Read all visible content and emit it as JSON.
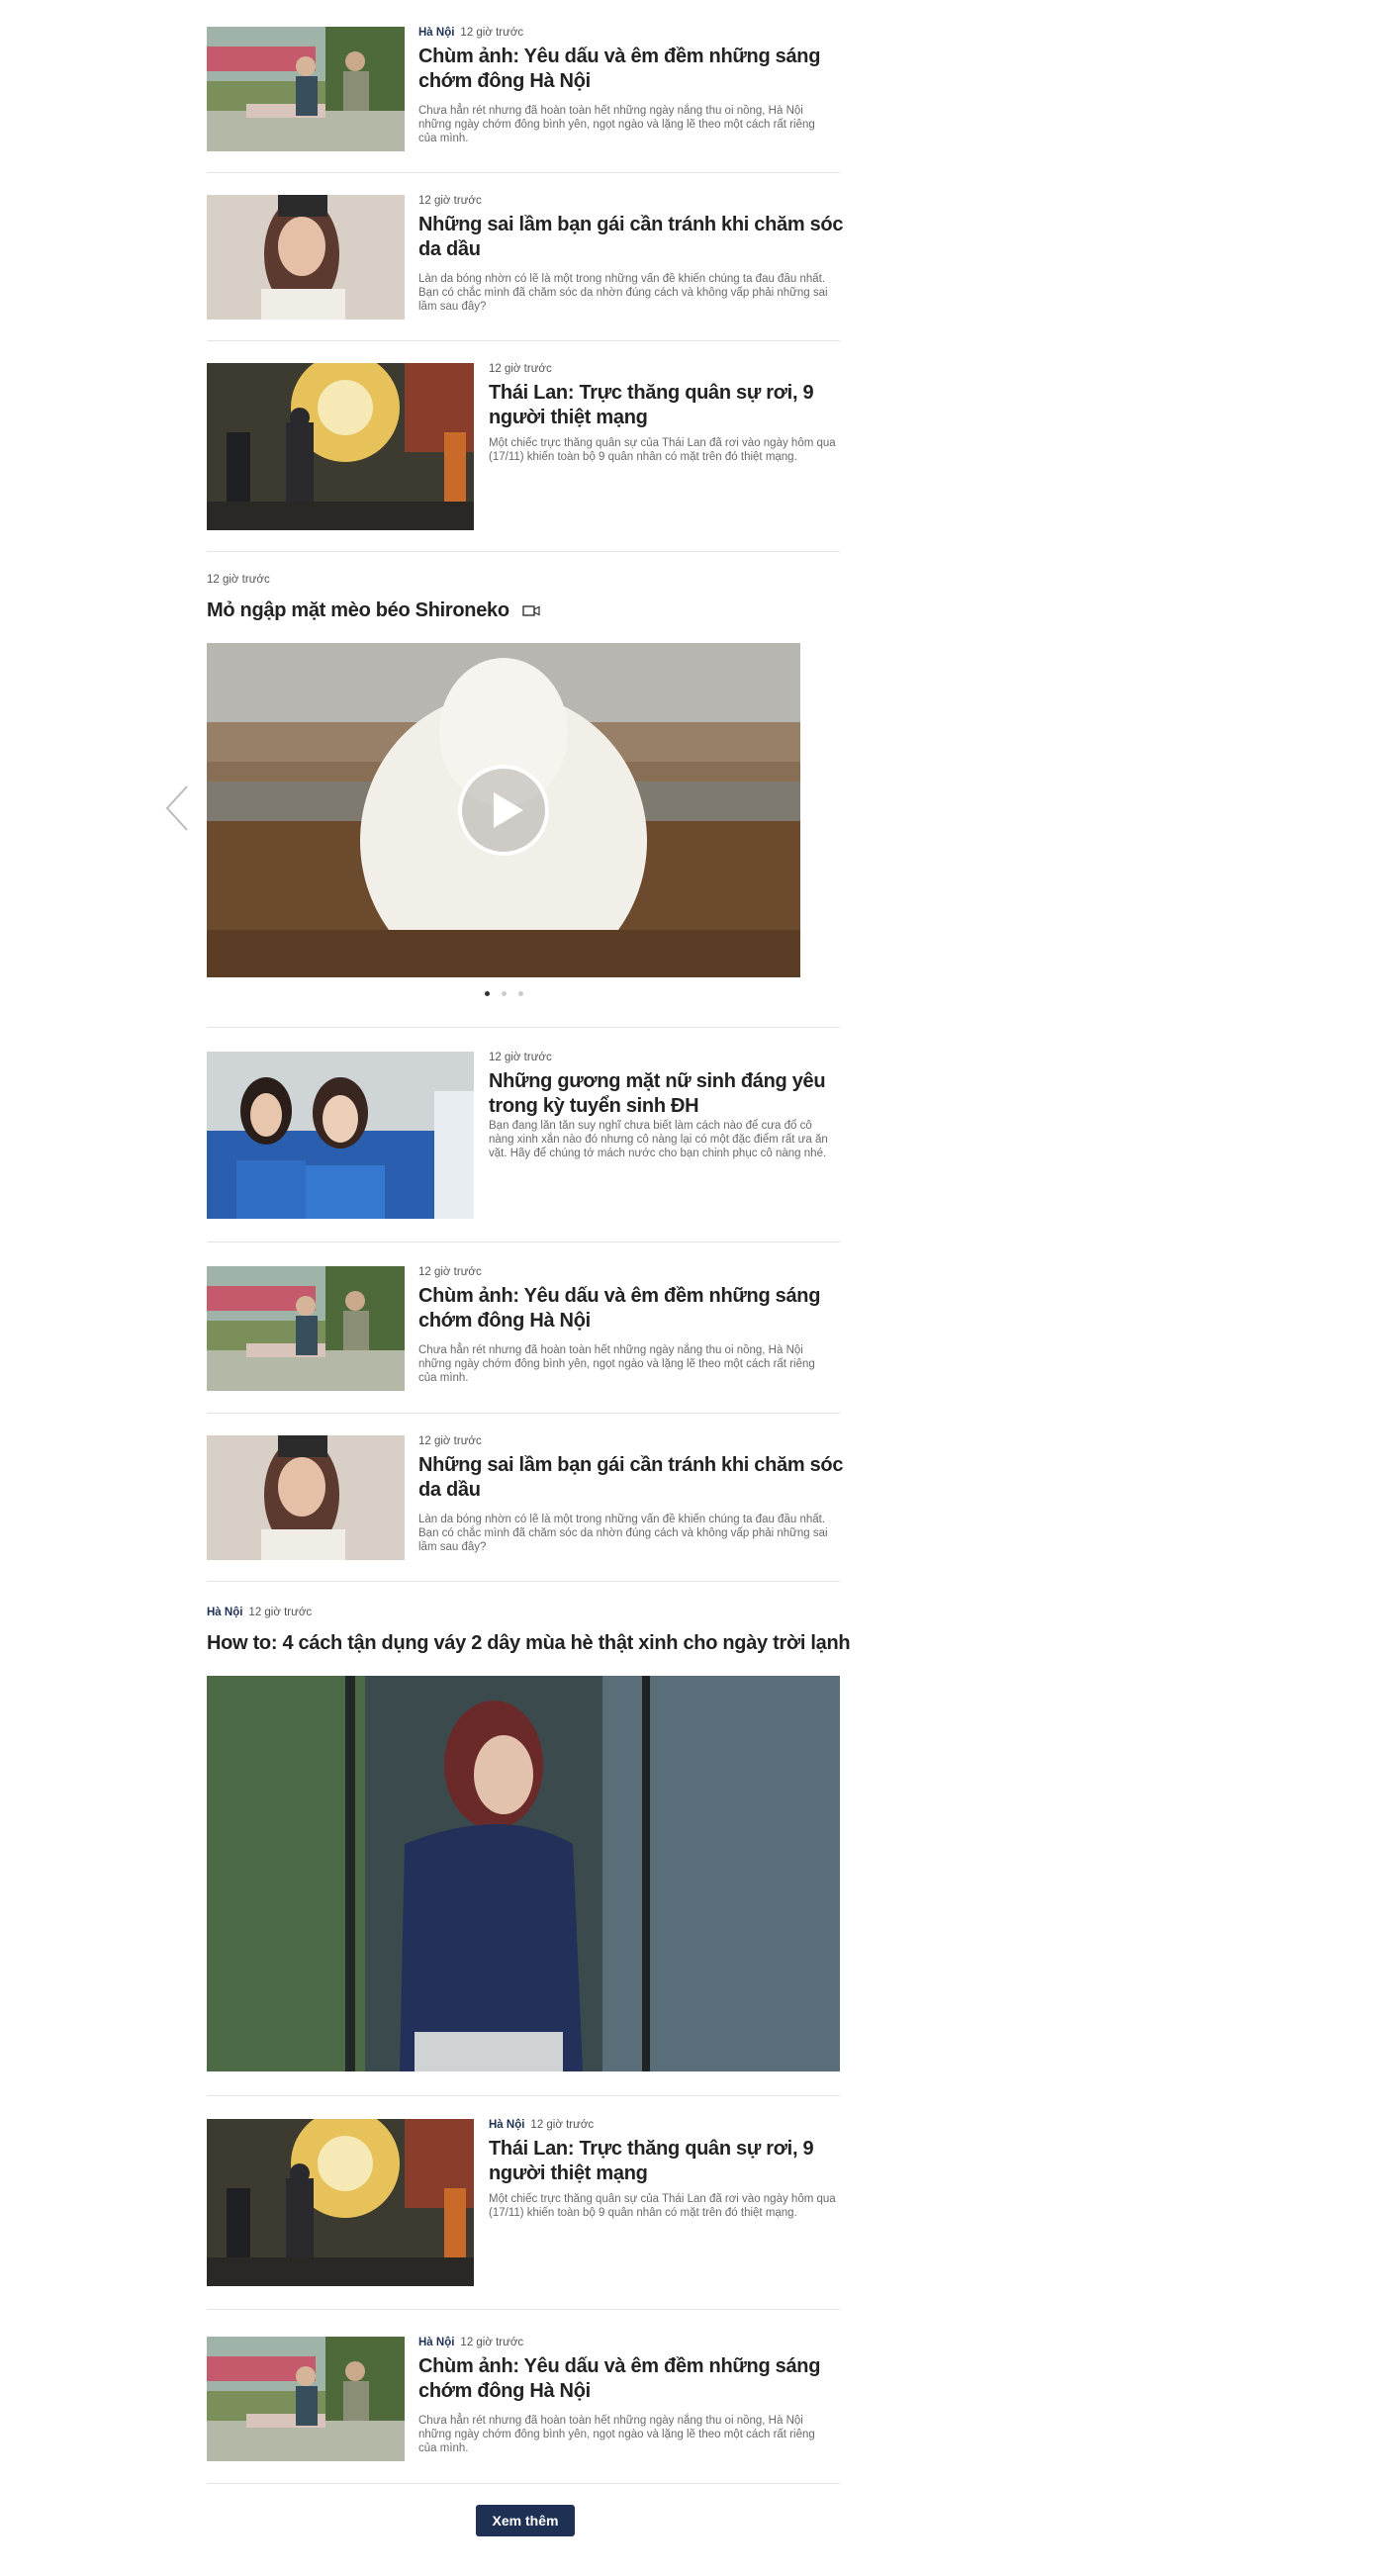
{
  "articles": [
    {
      "category": "Hà Nội",
      "time": "12 giờ trước",
      "title": "Chùm ảnh: Yêu dấu và êm đềm những sáng chớm đông Hà Nội",
      "desc": "Chưa hẳn rét nhưng đã hoàn toàn hết những ngày nắng thu oi nồng, Hà Nội những ngày chớm đông bình yên, ngọt ngào và lặng lẽ theo một cách rất riêng của mình.",
      "image": "park-bench-elderly"
    },
    {
      "time": "12 giờ trước",
      "title": "Những sai lầm bạn gái cần tránh khi chăm sóc da dầu",
      "desc": "Làn da bóng nhờn có lẽ là một trong những vấn đề khiến chúng ta đau đầu nhất. Bạn có chắc mình đã chăm sóc da nhờn đúng cách và không vấp phải những sai lầm sau đây?",
      "image": "girl-portrait"
    },
    {
      "time": "12 giờ trước",
      "title": "Thái Lan: Trực thăng quân sự rơi, 9 người thiệt mạng",
      "desc": "Một chiếc trực thăng quân sự của Thái Lan đã rơi vào ngày hôm qua (17/11) khiến toàn bộ 9 quân nhân có mặt trên đó thiệt mạng.",
      "image": "helicopter-crash-scene"
    },
    {
      "time": "12 giờ trước",
      "title": "Mỏ ngập mặt mèo béo Shironeko",
      "image": "white-cat-video",
      "video_icon": "video-camera-icon"
    },
    {
      "time": "12 giờ trước",
      "title": "Những gương mặt nữ sinh đáng yêu trong kỳ tuyển sinh ĐH",
      "desc": "Bạn đang lăn tăn suy nghĩ chưa biết làm cách nào để cưa đổ cô nàng xinh xắn nào đó nhưng cô nàng lại có một đặc điểm rất ưa ăn vặt. Hãy để chúng tớ mách nước cho bạn chinh phục cô nàng nhé.",
      "image": "students-blue-shirts"
    },
    {
      "time": "12 giờ trước",
      "title": "Chùm ảnh: Yêu dấu và êm đềm những sáng chớm đông Hà Nội",
      "desc": "Chưa hẳn rét nhưng đã hoàn toàn hết những ngày nắng thu oi nồng, Hà Nội những ngày chớm đông bình yên, ngọt ngào và lặng lẽ theo một cách rất riêng của mình.",
      "image": "park-bench-elderly"
    },
    {
      "time": "12 giờ trước",
      "title": "Những sai lầm bạn gái cần tránh khi chăm sóc da dầu",
      "desc": "Làn da bóng nhờn có lẽ là một trong những vấn đề khiến chúng ta đau đầu nhất. Bạn có chắc mình đã chăm sóc da nhờn đúng cách và không vấp phải những sai lầm sau đây?",
      "image": "girl-portrait"
    },
    {
      "category": "Hà Nội",
      "time": "12 giờ trước",
      "title": "How to: 4 cách tận dụng váy 2 dây mùa hè thật xinh cho ngày trời lạnh",
      "image": "girl-blue-sweater"
    },
    {
      "category": "Hà Nội",
      "time": "12 giờ trước",
      "title": "Thái Lan: Trực thăng quân sự rơi, 9 người thiệt mạng",
      "desc": "Một chiếc trực thăng quân sự của Thái Lan đã rơi vào ngày hôm qua (17/11) khiến toàn bộ 9 quân nhân có mặt trên đó thiệt mạng.",
      "image": "helicopter-crash-scene"
    },
    {
      "category": "Hà Nội",
      "time": "12 giờ trước",
      "title": "Chùm ảnh: Yêu dấu và êm đềm những sáng chớm đông Hà Nội",
      "desc": "Chưa hẳn rét nhưng đã hoàn toàn hết những ngày nắng thu oi nồng, Hà Nội những ngày chớm đông bình yên, ngọt ngào và lặng lẽ theo một cách rất riêng của mình.",
      "image": "park-bench-elderly"
    }
  ],
  "slider": {
    "active_index": 0,
    "count": 3,
    "prev_icon": "chevron-left-icon",
    "play_icon": "play-icon"
  },
  "load_more_label": "Xem thêm",
  "colors": {
    "accent": "#1e3054",
    "separator": "#e3e3e3"
  }
}
